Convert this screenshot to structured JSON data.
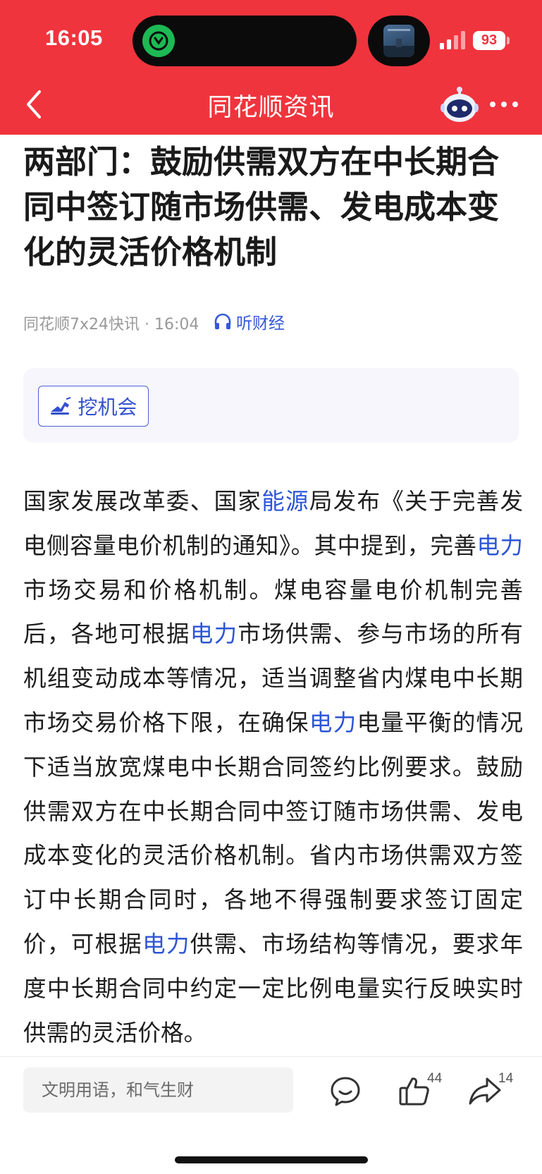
{
  "status_bar": {
    "time": "16:05",
    "battery": "93"
  },
  "nav": {
    "title": "同花顺资讯"
  },
  "article": {
    "title": "两部门：鼓励供需双方在中长期合同中签订随市场供需、发电成本变化的灵活价格机制",
    "meta": "同花顺7x24快讯 · 16:04",
    "listen_label": "听财经",
    "opportunity_label": "挖机会",
    "content": [
      {
        "text": "国家发展改革委、国家"
      },
      {
        "text": "能源",
        "link": true
      },
      {
        "text": "局发布《关于完善发电侧容量电价机制的通知》。其中提到，完善"
      },
      {
        "text": "电力",
        "link": true
      },
      {
        "text": "市场交易和价格机制。煤电容量电价机制完善后，各地可根据"
      },
      {
        "text": "电力",
        "link": true
      },
      {
        "text": "市场供需、参与市场的所有机组变动成本等情况，适当调整省内煤电中长期市场交易价格下限，在确保"
      },
      {
        "text": "电力",
        "link": true
      },
      {
        "text": "电量平衡的情况下适当放宽煤电中长期合同签约比例要求。鼓励供需双方在中长期合同中签订随市场供需、发电成本变化的灵活价格机制。省内市场供需双方签订中长期合同时，各地不得强制要求签订固定价，可根据"
      },
      {
        "text": "电力",
        "link": true
      },
      {
        "text": "供需、市场结构等情况，要求年度中长期合同中约定一定比例电量实行反映实时供需的灵活价格。"
      }
    ]
  },
  "bottom_bar": {
    "comment_placeholder": "文明用语，和气生财",
    "like_count": "44",
    "share_count": "14"
  },
  "colors": {
    "brand_red": "#f0343d",
    "link_blue": "#2d55d6"
  },
  "icons": [
    "back-arrow-icon",
    "robot-assistant-icon",
    "more-icon",
    "headphones-icon",
    "excavator-icon",
    "comment-icon",
    "like-icon",
    "share-icon"
  ]
}
